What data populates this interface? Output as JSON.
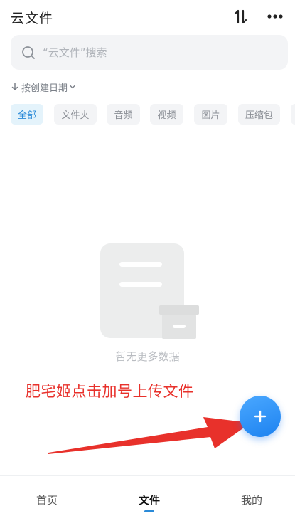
{
  "header": {
    "title": "云文件",
    "sort_icon": "sort-icon",
    "more_icon": "more-icon"
  },
  "search": {
    "placeholder": "“云文件”搜索",
    "value": ""
  },
  "sort": {
    "label": "按创建日期"
  },
  "filters": [
    {
      "label": "全部",
      "active": true
    },
    {
      "label": "文件夹"
    },
    {
      "label": "音频"
    },
    {
      "label": "视频"
    },
    {
      "label": "图片"
    },
    {
      "label": "压缩包"
    }
  ],
  "empty_state": {
    "text": "暂无更多数据"
  },
  "annotation": {
    "text": "肥宅姬点击加号上传文件"
  },
  "fab": {
    "icon": "plus-icon"
  },
  "tabbar": {
    "items": [
      {
        "label": "首页"
      },
      {
        "label": "文件",
        "active": true
      },
      {
        "label": "我的"
      }
    ]
  },
  "colors": {
    "accent": "#2a8ad8",
    "fab": "#2f8ff5",
    "annotation": "#e8312b",
    "chip_bg": "#f3f4f6",
    "chip_active_bg": "#e4f3fb"
  }
}
